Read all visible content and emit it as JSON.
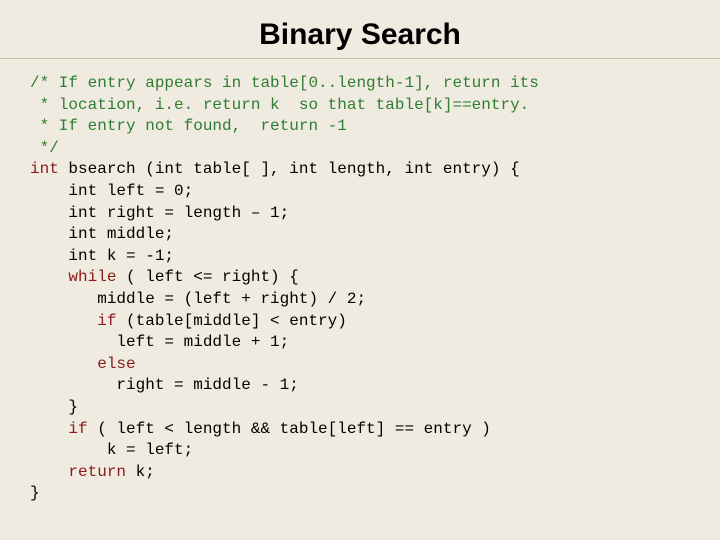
{
  "title": "Binary Search",
  "code": {
    "c1": "/* If entry appears in table[0..length-1], return its",
    "c2": " * location, i.e. return k  so that table[k]==entry.",
    "c3": " * If entry not found,  return -1",
    "c4": " */",
    "kw_int": "int",
    "sig_rest": " bsearch (int table[ ], int length, int entry) {",
    "l_left": "    int left = 0;",
    "l_right": "    int right = length – 1;",
    "l_middle": "    int middle;",
    "l_k": "    int k = -1;",
    "kw_while": "while",
    "while_rest": " ( left <= right) {",
    "l_mcalc": "       middle = (left + right) / 2;",
    "kw_if1": "if",
    "if1_rest": " (table[middle] < entry)",
    "l_lset": "         left = middle + 1;",
    "kw_else": "else",
    "l_rset": "         right = middle - 1;",
    "l_endw": "    }",
    "kw_if2": "if",
    "if2_rest": " ( left < length && table[left] == entry )",
    "l_kset": "        k = left;",
    "kw_return": "return",
    "ret_rest": " k;",
    "l_end": "}"
  }
}
